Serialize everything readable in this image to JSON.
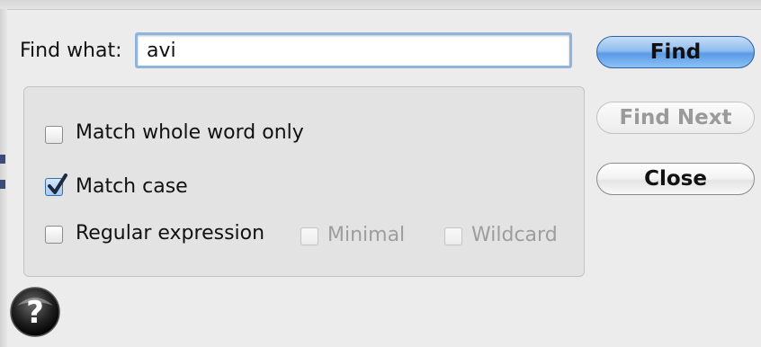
{
  "find": {
    "label": "Find what:",
    "value": "avi"
  },
  "options": {
    "match_whole_word": {
      "label": "Match whole word only",
      "checked": false
    },
    "match_case": {
      "label": "Match case",
      "checked": true
    },
    "regular_expression": {
      "label": "Regular expression",
      "checked": false
    },
    "minimal": {
      "label": "Minimal",
      "checked": false,
      "enabled": false
    },
    "wildcard": {
      "label": "Wildcard",
      "checked": false,
      "enabled": false
    }
  },
  "buttons": {
    "find": "Find",
    "find_next": "Find Next",
    "close": "Close"
  },
  "icons": {
    "help": "help-icon",
    "checkmark": "checkmark-icon"
  },
  "colors": {
    "accent": "#5a9ae6",
    "focus_ring": "#8fb3df"
  }
}
